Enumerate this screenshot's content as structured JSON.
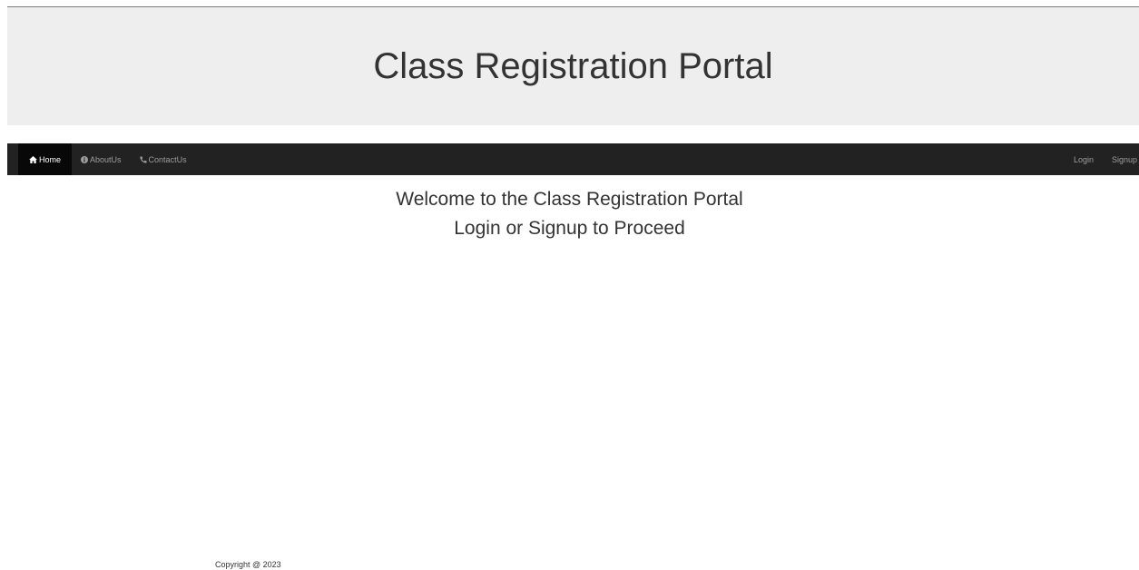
{
  "header": {
    "title": "Class Registration Portal"
  },
  "navbar": {
    "left_items": [
      {
        "label": "Home",
        "icon": "home-icon",
        "active": true
      },
      {
        "label": "AboutUs",
        "icon": "info-circle-icon",
        "active": false
      },
      {
        "label": "ContactUs",
        "icon": "phone-icon",
        "active": false
      }
    ],
    "right_items": [
      {
        "label": "Login"
      },
      {
        "label": "Signup"
      }
    ],
    "colors": {
      "background": "#222222",
      "active_background": "#080808",
      "text": "#9d9d9d",
      "active_text": "#ffffff"
    }
  },
  "main": {
    "welcome_line": "Welcome to the Class Registration Portal",
    "instruction_line": "Login or Signup to Proceed"
  },
  "footer": {
    "copyright": "Copyright @ 2023"
  }
}
